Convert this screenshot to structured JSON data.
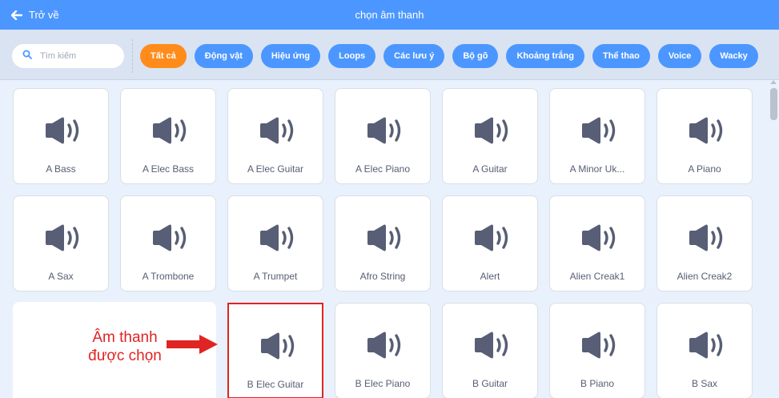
{
  "header": {
    "back_label": "Trở về",
    "title": "chọn âm thanh"
  },
  "search": {
    "placeholder": "Tìm kiếm"
  },
  "tags": [
    {
      "label": "Tất cả",
      "active": true
    },
    {
      "label": "Động vật"
    },
    {
      "label": "Hiệu ứng"
    },
    {
      "label": "Loops"
    },
    {
      "label": "Các lưu ý"
    },
    {
      "label": "Bộ gõ"
    },
    {
      "label": "Khoảng trắng"
    },
    {
      "label": "Thể thao"
    },
    {
      "label": "Voice"
    },
    {
      "label": "Wacky"
    }
  ],
  "sounds": [
    "A Bass",
    "A Elec Bass",
    "A Elec Guitar",
    "A Elec Piano",
    "A Guitar",
    "A Minor Uk...",
    "A Piano",
    "A Sax",
    "A Trombone",
    "A Trumpet",
    "Afro String",
    "Alert",
    "Alien Creak1",
    "Alien Creak2",
    "B Elec Guitar",
    "B Elec Piano",
    "B Guitar",
    "B Piano",
    "B Sax"
  ],
  "selected_sound": "B Elec Guitar",
  "annotation": {
    "line1": "Âm thanh",
    "line2": "được chọn"
  },
  "colors": {
    "header": "#4c97ff",
    "active_tag": "#ff8c1a",
    "annotation": "#e02424",
    "icon": "#575e75"
  }
}
